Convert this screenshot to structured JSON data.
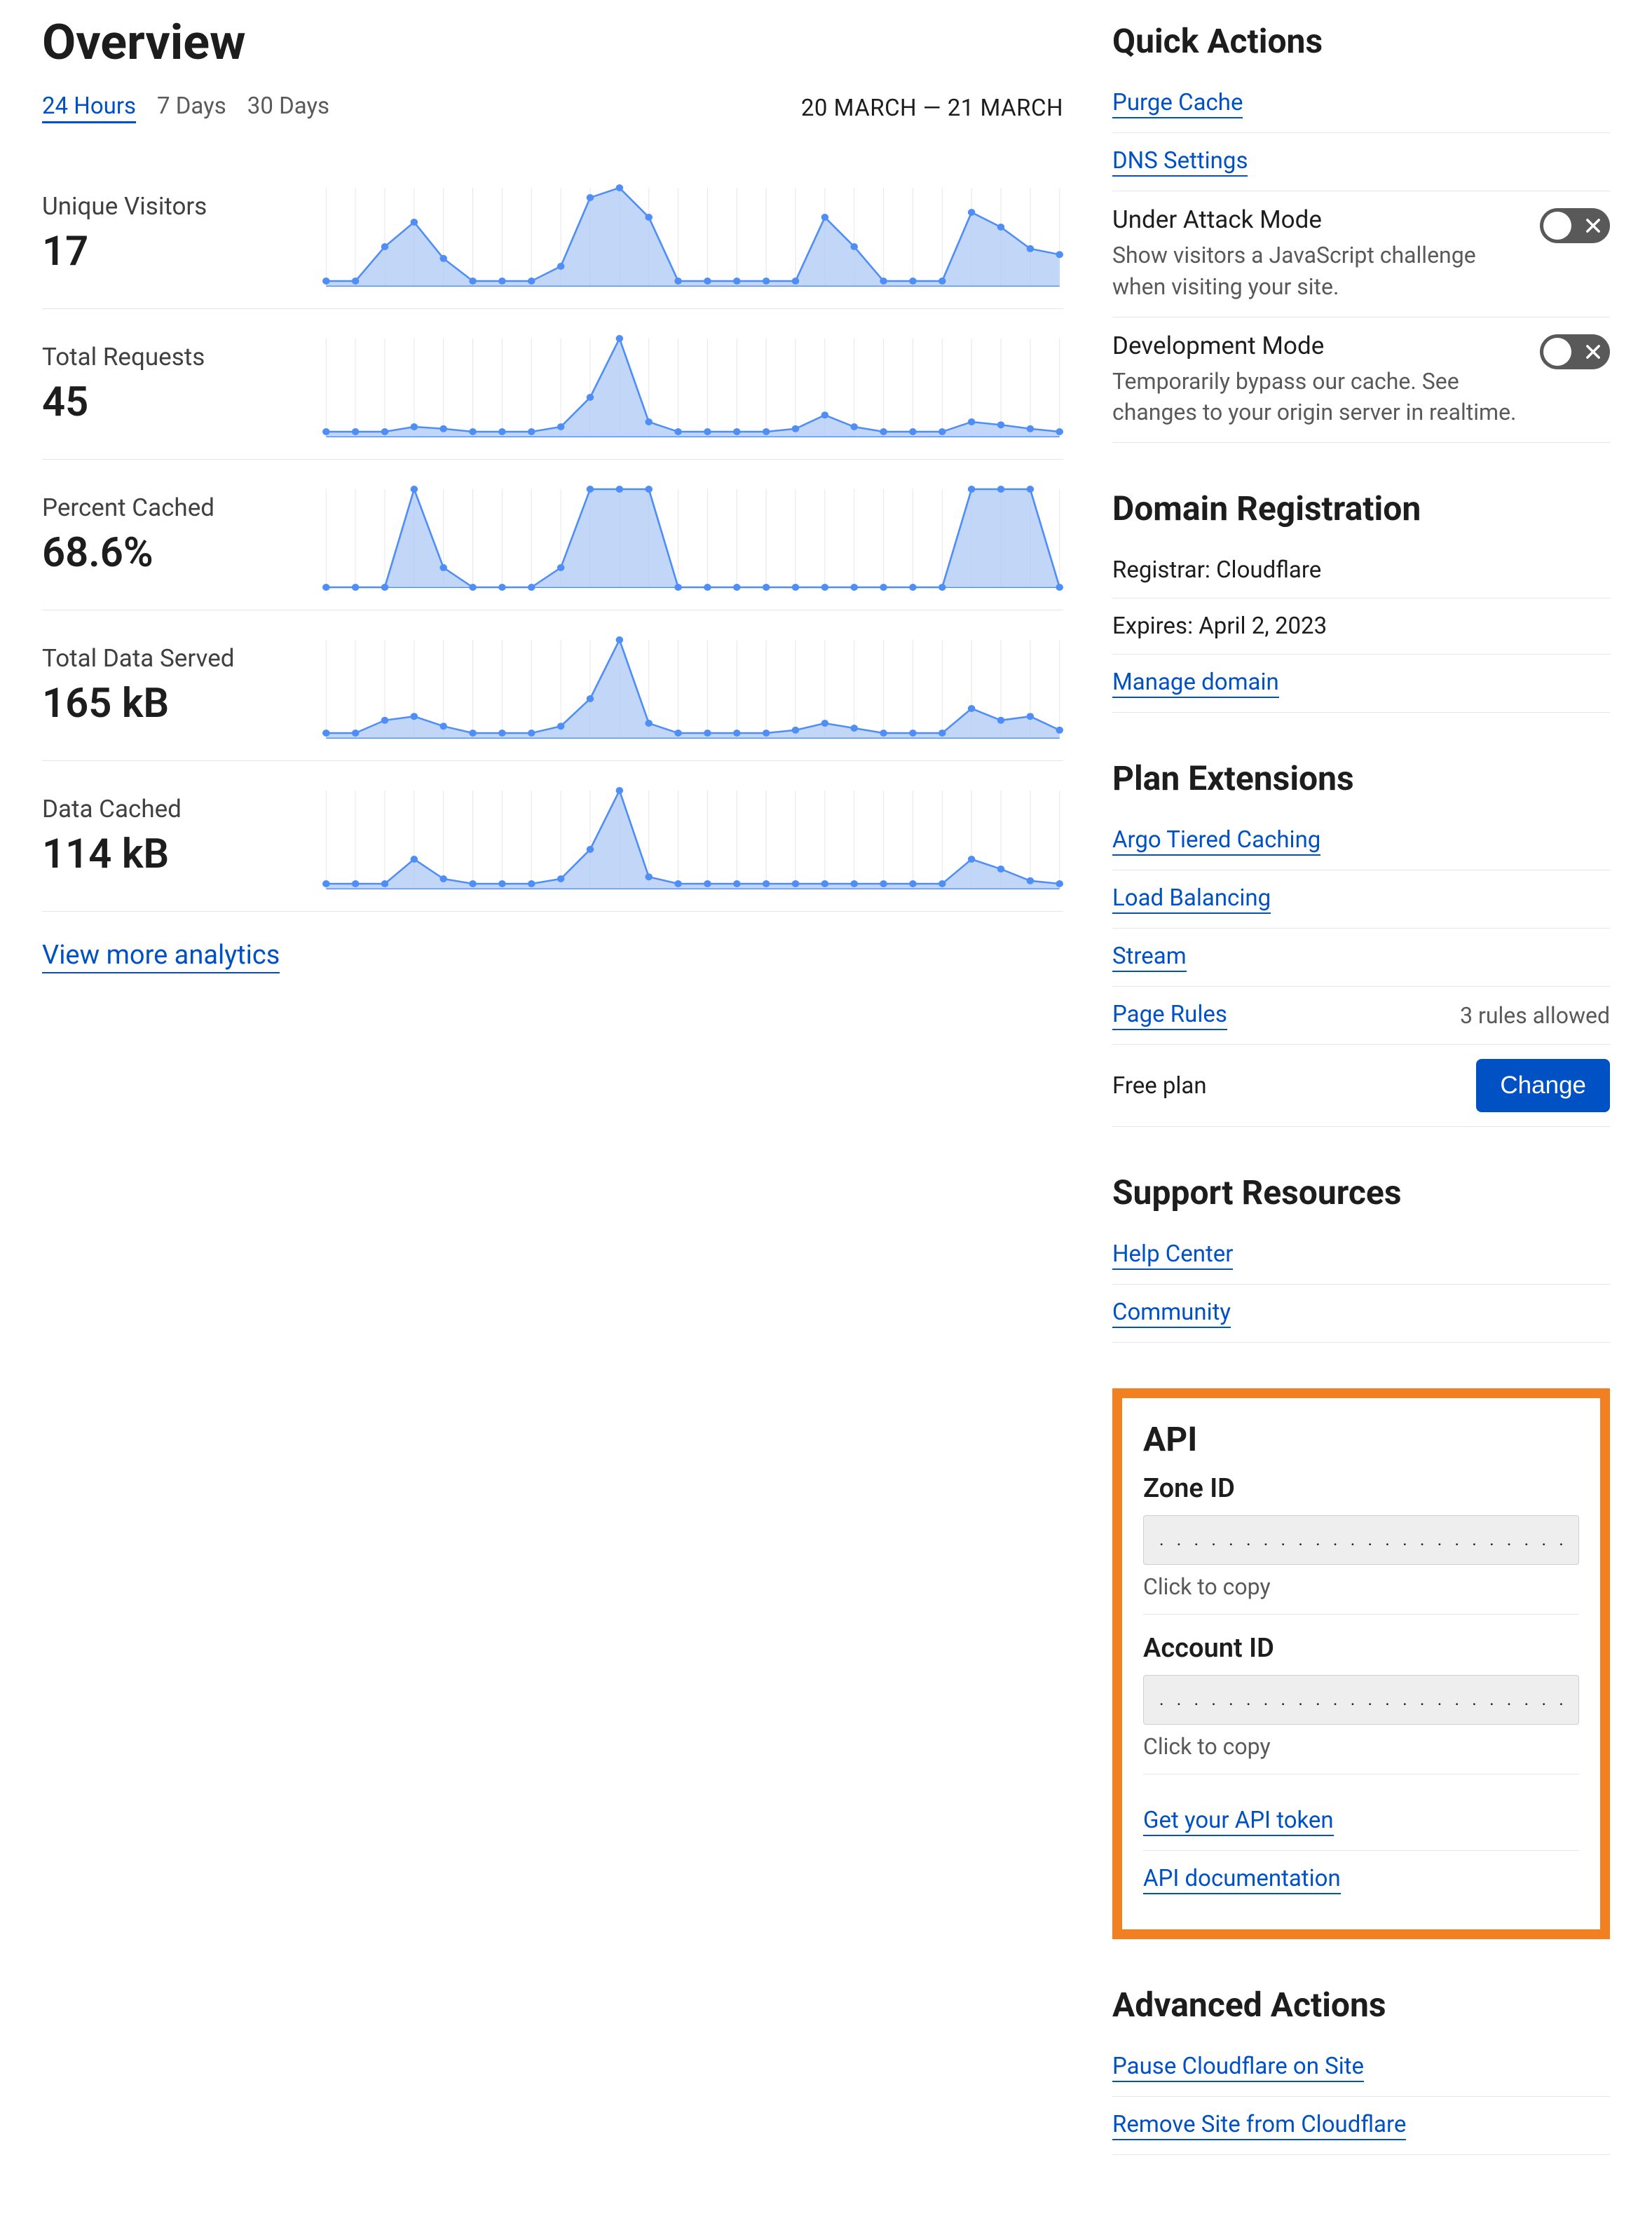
{
  "page_title": "Overview",
  "time_tabs": [
    "24 Hours",
    "7 Days",
    "30 Days"
  ],
  "active_tab_index": 0,
  "date_range": "20 MARCH — 21 MARCH",
  "metrics": [
    {
      "label": "Unique Visitors",
      "value": "17"
    },
    {
      "label": "Total Requests",
      "value": "45"
    },
    {
      "label": "Percent Cached",
      "value": "68.6%"
    },
    {
      "label": "Total Data Served",
      "value": "165 kB"
    },
    {
      "label": "Data Cached",
      "value": "114 kB"
    }
  ],
  "view_more": "View more analytics",
  "quick_actions": {
    "title": "Quick Actions",
    "purge": "Purge Cache",
    "dns": "DNS Settings",
    "under_attack": {
      "title": "Under Attack Mode",
      "desc": "Show visitors a JavaScript challenge when visiting your site."
    },
    "dev_mode": {
      "title": "Development Mode",
      "desc": "Temporarily bypass our cache. See changes to your origin server in realtime."
    }
  },
  "domain_reg": {
    "title": "Domain Registration",
    "registrar": "Registrar: Cloudflare",
    "expires": "Expires: April 2, 2023",
    "manage": "Manage domain"
  },
  "plan_ext": {
    "title": "Plan Extensions",
    "argo": "Argo Tiered Caching",
    "lb": "Load Balancing",
    "stream": "Stream",
    "page_rules": "Page Rules",
    "rules_allowed": "3 rules allowed",
    "free_plan": "Free plan",
    "change": "Change"
  },
  "support": {
    "title": "Support Resources",
    "help": "Help Center",
    "community": "Community"
  },
  "api": {
    "title": "API",
    "zone_label": "Zone ID",
    "account_label": "Account ID",
    "masked": ". . . . . . . . . . . . . . . . . . . . . . . . . . .",
    "copy_hint": "Click to copy",
    "get_token": "Get your API token",
    "docs": "API documentation"
  },
  "advanced": {
    "title": "Advanced Actions",
    "pause": "Pause Cloudflare on Site",
    "remove": "Remove Site from Cloudflare"
  },
  "chart_data": [
    {
      "type": "area",
      "metric": "Unique Visitors",
      "x_count": 25,
      "values_rel": [
        5,
        5,
        40,
        65,
        28,
        5,
        5,
        5,
        20,
        90,
        100,
        70,
        5,
        5,
        5,
        5,
        5,
        70,
        40,
        5,
        5,
        5,
        75,
        60,
        38,
        32
      ],
      "ylim_rel": [
        0,
        100
      ]
    },
    {
      "type": "area",
      "metric": "Total Requests",
      "x_count": 25,
      "values_rel": [
        5,
        5,
        5,
        10,
        8,
        5,
        5,
        5,
        10,
        40,
        100,
        15,
        5,
        5,
        5,
        5,
        8,
        22,
        10,
        5,
        5,
        5,
        15,
        12,
        8,
        5
      ],
      "ylim_rel": [
        0,
        100
      ]
    },
    {
      "type": "area",
      "metric": "Percent Cached",
      "x_count": 25,
      "values_rel": [
        0,
        0,
        0,
        100,
        20,
        0,
        0,
        0,
        20,
        100,
        100,
        100,
        0,
        0,
        0,
        0,
        0,
        0,
        0,
        0,
        0,
        0,
        100,
        100,
        100,
        0
      ],
      "ylim_rel": [
        0,
        100
      ]
    },
    {
      "type": "area",
      "metric": "Total Data Served",
      "x_count": 25,
      "values_rel": [
        5,
        5,
        18,
        22,
        12,
        5,
        5,
        5,
        12,
        40,
        100,
        15,
        5,
        5,
        5,
        5,
        8,
        15,
        10,
        5,
        5,
        5,
        30,
        18,
        22,
        8
      ],
      "ylim_rel": [
        0,
        100
      ]
    },
    {
      "type": "area",
      "metric": "Data Cached",
      "x_count": 25,
      "values_rel": [
        5,
        5,
        5,
        30,
        10,
        5,
        5,
        5,
        10,
        40,
        100,
        12,
        5,
        5,
        5,
        5,
        5,
        5,
        5,
        5,
        5,
        5,
        30,
        20,
        8,
        5
      ],
      "ylim_rel": [
        0,
        100
      ]
    }
  ]
}
